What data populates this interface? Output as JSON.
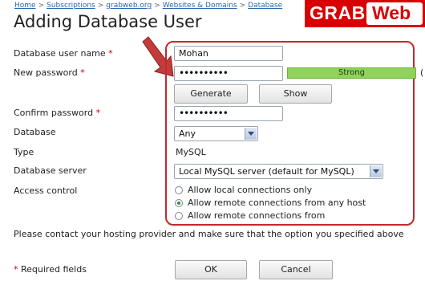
{
  "breadcrumb": [
    "Home",
    "Subscriptions",
    "grabweb.org",
    "Websites & Domains",
    "Database"
  ],
  "breadcrumb_separator": ">",
  "page_title": "Adding Database User",
  "logo": {
    "part1": "GRAB",
    "part2": "Web",
    "bg": "#d80000"
  },
  "required_mark": "*",
  "form": {
    "username_label": "Database user name",
    "username_value": "Mohan",
    "password_label": "New password",
    "password_value": "••••••••••",
    "strength_label": "Strong",
    "strength_extra": "(",
    "generate_label": "Generate",
    "show_label": "Show",
    "confirm_label": "Confirm password",
    "confirm_value": "••••••••••",
    "database_label": "Database",
    "database_value": "Any",
    "type_label": "Type",
    "type_value": "MySQL",
    "server_label": "Database server",
    "server_value": "Local MySQL server (default for MySQL)",
    "access_label": "Access control",
    "access_options": [
      {
        "label": "Allow local connections only",
        "selected": false
      },
      {
        "label": "Allow remote connections from any host",
        "selected": true
      },
      {
        "label": "Allow remote connections from",
        "selected": false
      }
    ]
  },
  "note": "Please contact your hosting provider and make sure that the option you specified above",
  "required_fields_label": "Required fields",
  "ok_label": "OK",
  "cancel_label": "Cancel",
  "colors": {
    "highlight": "#c22a2a",
    "arrow": "#c43b3b",
    "strength": "#8fd35a",
    "link": "#2a66b3"
  }
}
